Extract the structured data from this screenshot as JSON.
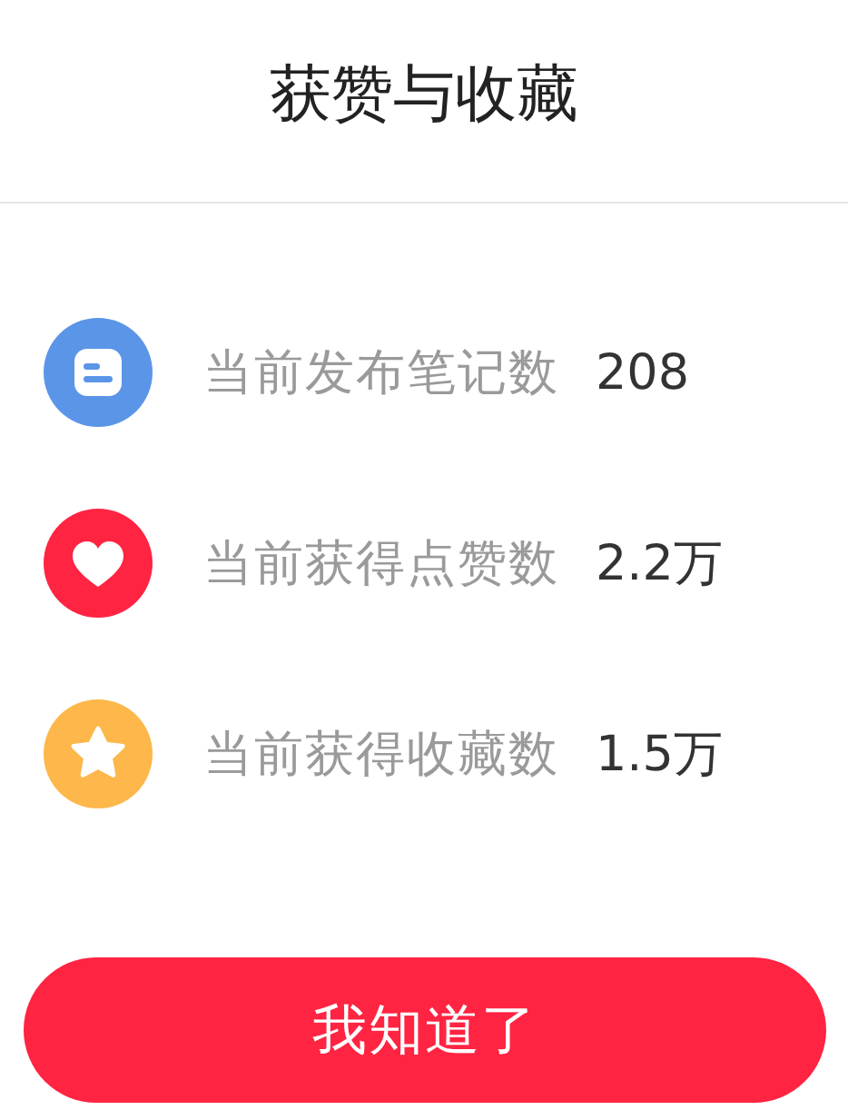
{
  "title": "获赞与收藏",
  "stats": [
    {
      "kind": "note",
      "color": "#5b95e8",
      "label": "当前发布笔记数",
      "value": "208"
    },
    {
      "kind": "heart",
      "color": "#ff2442",
      "label": "当前获得点赞数",
      "value": "2.2万"
    },
    {
      "kind": "star",
      "color": "#fdb74a",
      "label": "当前获得收藏数",
      "value": "1.5万"
    }
  ],
  "button": "我知道了"
}
